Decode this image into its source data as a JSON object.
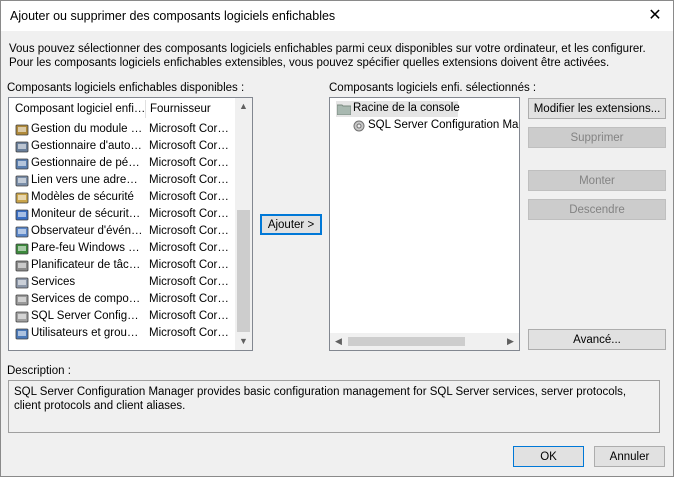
{
  "window": {
    "title": "Ajouter ou supprimer des composants logiciels enfichables",
    "close_label": "✕"
  },
  "intro": "Vous pouvez sélectionner des composants logiciels enfichables parmi ceux disponibles sur votre ordinateur, et les configurer. Pour les composants logiciels enfichables extensibles, vous pouvez spécifier quelles extensions doivent être activées.",
  "available": {
    "label": "Composants logiciels enfichables disponibles :",
    "col_name": "Composant logiciel enfi…",
    "col_vendor": "Fournisseur",
    "items": [
      {
        "name": "Gestion du module de plateforme sécurisée",
        "vendor": "Microsoft Corporation",
        "icon": "tpm-icon",
        "color": "#b08a3a"
      },
      {
        "name": "Gestionnaire d'autorisations",
        "vendor": "Microsoft Corporation",
        "icon": "authorization-manager-icon",
        "color": "#6a7f9a"
      },
      {
        "name": "Gestionnaire de périphériques",
        "vendor": "Microsoft Corporation",
        "icon": "device-manager-icon",
        "color": "#5b7fb0"
      },
      {
        "name": "Lien vers une adresse Web",
        "vendor": "Microsoft Corporation",
        "icon": "web-link-icon",
        "color": "#7a8ea8"
      },
      {
        "name": "Modèles de sécurité",
        "vendor": "Microsoft Corporation",
        "icon": "security-templates-icon",
        "color": "#c9a44a"
      },
      {
        "name": "Moniteur de sécurité IP",
        "vendor": "Microsoft Corporation",
        "icon": "ip-security-monitor-icon",
        "color": "#3a6fc4"
      },
      {
        "name": "Observateur d'événements",
        "vendor": "Microsoft Corporation",
        "icon": "event-viewer-icon",
        "color": "#5a86c8"
      },
      {
        "name": "Pare-feu Windows Defender",
        "vendor": "Microsoft Corporation",
        "icon": "firewall-icon",
        "color": "#3c8a3c"
      },
      {
        "name": "Planificateur de tâches",
        "vendor": "Microsoft Corporation",
        "icon": "task-scheduler-icon",
        "color": "#8a8a8a"
      },
      {
        "name": "Services",
        "vendor": "Microsoft Corporation",
        "icon": "services-icon",
        "color": "#8c97a8"
      },
      {
        "name": "Services de composants",
        "vendor": "Microsoft Corporation",
        "icon": "component-services-icon",
        "color": "#9a9a9a"
      },
      {
        "name": "SQL Server Configuration Manager",
        "vendor": "Microsoft Corporation",
        "icon": "sql-config-icon",
        "color": "#a0a0a0"
      },
      {
        "name": "Utilisateurs et groupes locaux",
        "vendor": "Microsoft Corporation",
        "icon": "users-groups-icon",
        "color": "#4a78b8"
      }
    ]
  },
  "add_button": "Ajouter >",
  "selected": {
    "label": "Composants logiciels enfi. sélectionnés :",
    "root": "Racine de la console",
    "child": "SQL Server Configuration Manager"
  },
  "buttons": {
    "modify": "Modifier les extensions...",
    "remove": "Supprimer",
    "up": "Monter",
    "down": "Descendre",
    "advanced": "Avancé...",
    "ok": "OK",
    "cancel": "Annuler"
  },
  "description": {
    "label": "Description :",
    "text": "SQL Server Configuration Manager provides basic configuration management for SQL Server services, server protocols, client protocols and client aliases."
  }
}
